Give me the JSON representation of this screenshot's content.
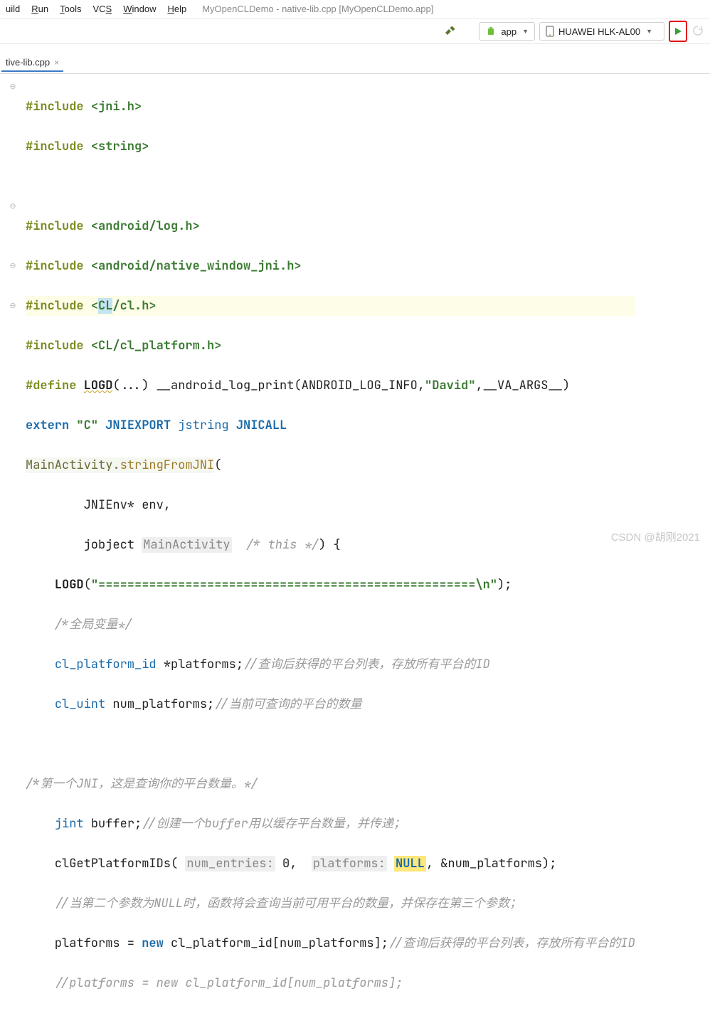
{
  "menu": {
    "items": [
      "uild",
      "Run",
      "Tools",
      "VCS",
      "Window",
      "Help"
    ],
    "title": "MyOpenCLDemo - native-lib.cpp [MyOpenCLDemo.app]"
  },
  "toolbar": {
    "config": "app",
    "device": "HUAWEI HLK-AL00"
  },
  "tab": {
    "name": "tive-lib.cpp"
  },
  "code": {
    "l1a": "#include ",
    "l1b": "<jni.h>",
    "l2a": "#include ",
    "l2b": "<string>",
    "l4a": "#include ",
    "l4b": "<android/log.h>",
    "l5a": "#include ",
    "l5b": "<android/native_window_jni.h>",
    "l6a": "#include ",
    "l6b": "<",
    "l6c": "CL",
    "l6d": "/cl.h>",
    "l7a": "#include ",
    "l7b": "<CL/cl_platform.h>",
    "l8a": "#define ",
    "l8b": "LOGD",
    "l8c": "(...) __android_log_print(ANDROID_LOG_INFO,",
    "l8d": "\"David\"",
    "l8e": ",__VA_ARGS__)",
    "l9a": "extern ",
    "l9b": "\"C\"",
    "l9c": " JNIEXPORT ",
    "l9d": "jstring ",
    "l9e": "JNICALL",
    "l10a": "MainActivity.",
    "l10b": "stringFromJNI",
    "l10c": "(",
    "l11": "        JNIEnv* env,",
    "l12a": "        jobject ",
    "l12b": "MainActivity",
    "l12c": "  /* this */",
    "l12d": ") {",
    "l13a": "    LOGD",
    "l13b": "(",
    "l13c": "\"====================================================\\n\"",
    "l13d": ");",
    "l14": "    /*全局变量*/",
    "l15a": "    ",
    "l15b": "cl_platform_id",
    "l15c": " *platforms;",
    "l15d": "//查询后获得的平台列表，存放所有平台的ID",
    "l16a": "    ",
    "l16b": "cl_uint",
    "l16c": " num_platforms;",
    "l16d": "//当前可查询的平台的数量",
    "l18": "/*第一个JNI，这是查询你的平台数量。*/",
    "l19a": "    ",
    "l19b": "jint",
    "l19c": " buffer;",
    "l19d": "//创建一个buffer用以缓存平台数量，并传递；",
    "l20a": "    clGetPlatformIDs( ",
    "l20b": "num_entries:",
    "l20c": " 0,  ",
    "l20d": "platforms:",
    "l20e": " ",
    "l20f": "NULL",
    "l20g": ", &num_platforms);",
    "l21": "    //当第二个参数为NULL时，函数将会查询当前可用平台的数量，并保存在第三个参数；",
    "l22a": "    platforms = ",
    "l22b": "new",
    "l22c": " cl_platform_id[num_platforms];",
    "l22d": "//查询后获得的平台列表，存放所有平台的ID",
    "l23": "    //platforms = new cl_platform_id[num_platforms];"
  },
  "watermark": "CSDN @胡刚2021"
}
